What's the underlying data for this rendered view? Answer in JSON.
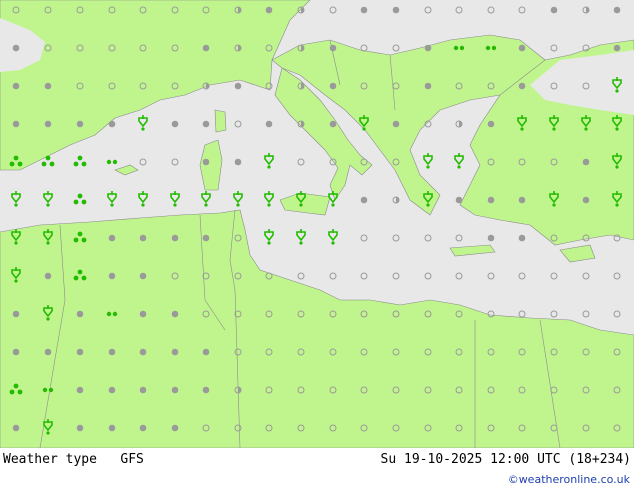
{
  "title": "Weather type   GFS",
  "datetime": "Su 19-10-2025 12:00 UTC (18+234)",
  "credit": "©weatheronline.co.uk",
  "colors": {
    "land": "#c0f58e",
    "sea": "#e8e8e8",
    "border": "#999999",
    "symbol_green": "#22bb00",
    "dot_gray": "#9a9a9a"
  },
  "symbol_types": [
    "cloudy-dot",
    "hollow-dot",
    "half-dot",
    "rain-shower",
    "drizzle",
    "light-rain",
    "showers-heavy"
  ]
}
